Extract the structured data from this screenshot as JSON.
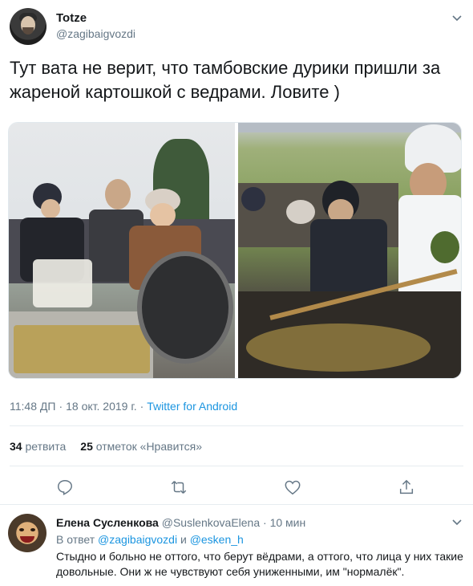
{
  "tweet": {
    "author_name": "Totze",
    "author_handle": "@zagibaigvozdi",
    "text": "Тут вата не верит, что тамбовские дурики пришли за жареной картошкой с ведрами. Ловите )",
    "time": "11:48 ДП",
    "date": "18 окт. 2019 г.",
    "source": "Twitter for Android",
    "retweets_count": "34",
    "retweets_label": "ретвита",
    "likes_count": "25",
    "likes_label": "отметок «Нравится»",
    "icons": [
      "reply-icon",
      "retweet-icon",
      "like-icon",
      "share-icon",
      "chevron-down-icon"
    ]
  },
  "reply": {
    "author_name": "Елена Сусленкова",
    "author_handle": "@SuslenkovaElena",
    "time_ago": "10 мин",
    "replying_prefix": "В ответ",
    "mention_1": "@zagibaigvozdi",
    "conjunction": "и",
    "mention_2": "@esken_h",
    "text": "Стыдно и больно не оттого, что берут вёдрами, а оттого, что лица у них такие довольные. Они ж не чувствуют себя униженными, им \"нормалёк\"."
  },
  "colors": {
    "link": "#1b95e0",
    "muted": "#657786",
    "text": "#14171a",
    "border": "#e6ecf0"
  }
}
